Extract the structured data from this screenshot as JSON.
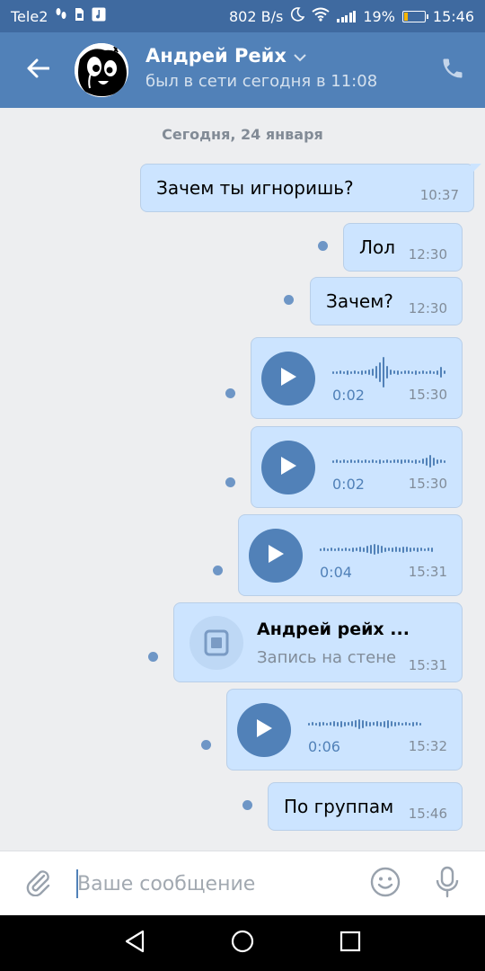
{
  "status_bar": {
    "carrier": "Tele2",
    "speed": "802 B/s",
    "battery": "19%",
    "battery_level": 0.19,
    "time": "15:46",
    "icons": [
      "footprint-icon",
      "sim-icon",
      "music-icon",
      "moon-icon",
      "wifi-icon",
      "signal-icon",
      "battery-icon"
    ]
  },
  "header": {
    "name": "Андрей Рейх",
    "status": "был в сети сегодня в 11:08",
    "icons": [
      "back-arrow-icon",
      "avatar",
      "chevron-down-icon",
      "phone-icon"
    ]
  },
  "chat": {
    "date": "Сегодня, 24 января",
    "messages": [
      {
        "text": "Зачем ты игноришь?",
        "time": "10:37"
      },
      {
        "text": "Лол",
        "time": "12:30"
      },
      {
        "text": "Зачем?",
        "time": "12:30"
      },
      {
        "duration": "0:02",
        "time": "15:30"
      },
      {
        "duration": "0:02",
        "time": "15:30"
      },
      {
        "duration": "0:04",
        "time": "15:31"
      },
      {
        "title": "Андрей рейх ...",
        "subtitle": "Запись на стене",
        "time": "15:31"
      },
      {
        "duration": "0:06",
        "time": "15:32"
      },
      {
        "text": "По группам",
        "time": "15:46"
      }
    ]
  },
  "composer": {
    "placeholder": "Ваше сообщение",
    "icons": [
      "paperclip-icon",
      "smile-icon",
      "microphone-icon"
    ]
  },
  "navbar": {
    "icons": [
      "back-triangle-icon",
      "home-circle-icon",
      "recents-square-icon"
    ]
  },
  "colors": {
    "status_bar": "#3f6aa0",
    "header": "#5181b8",
    "bubble": "#cce4ff",
    "background": "#edeef0",
    "accent": "#5181b8"
  }
}
